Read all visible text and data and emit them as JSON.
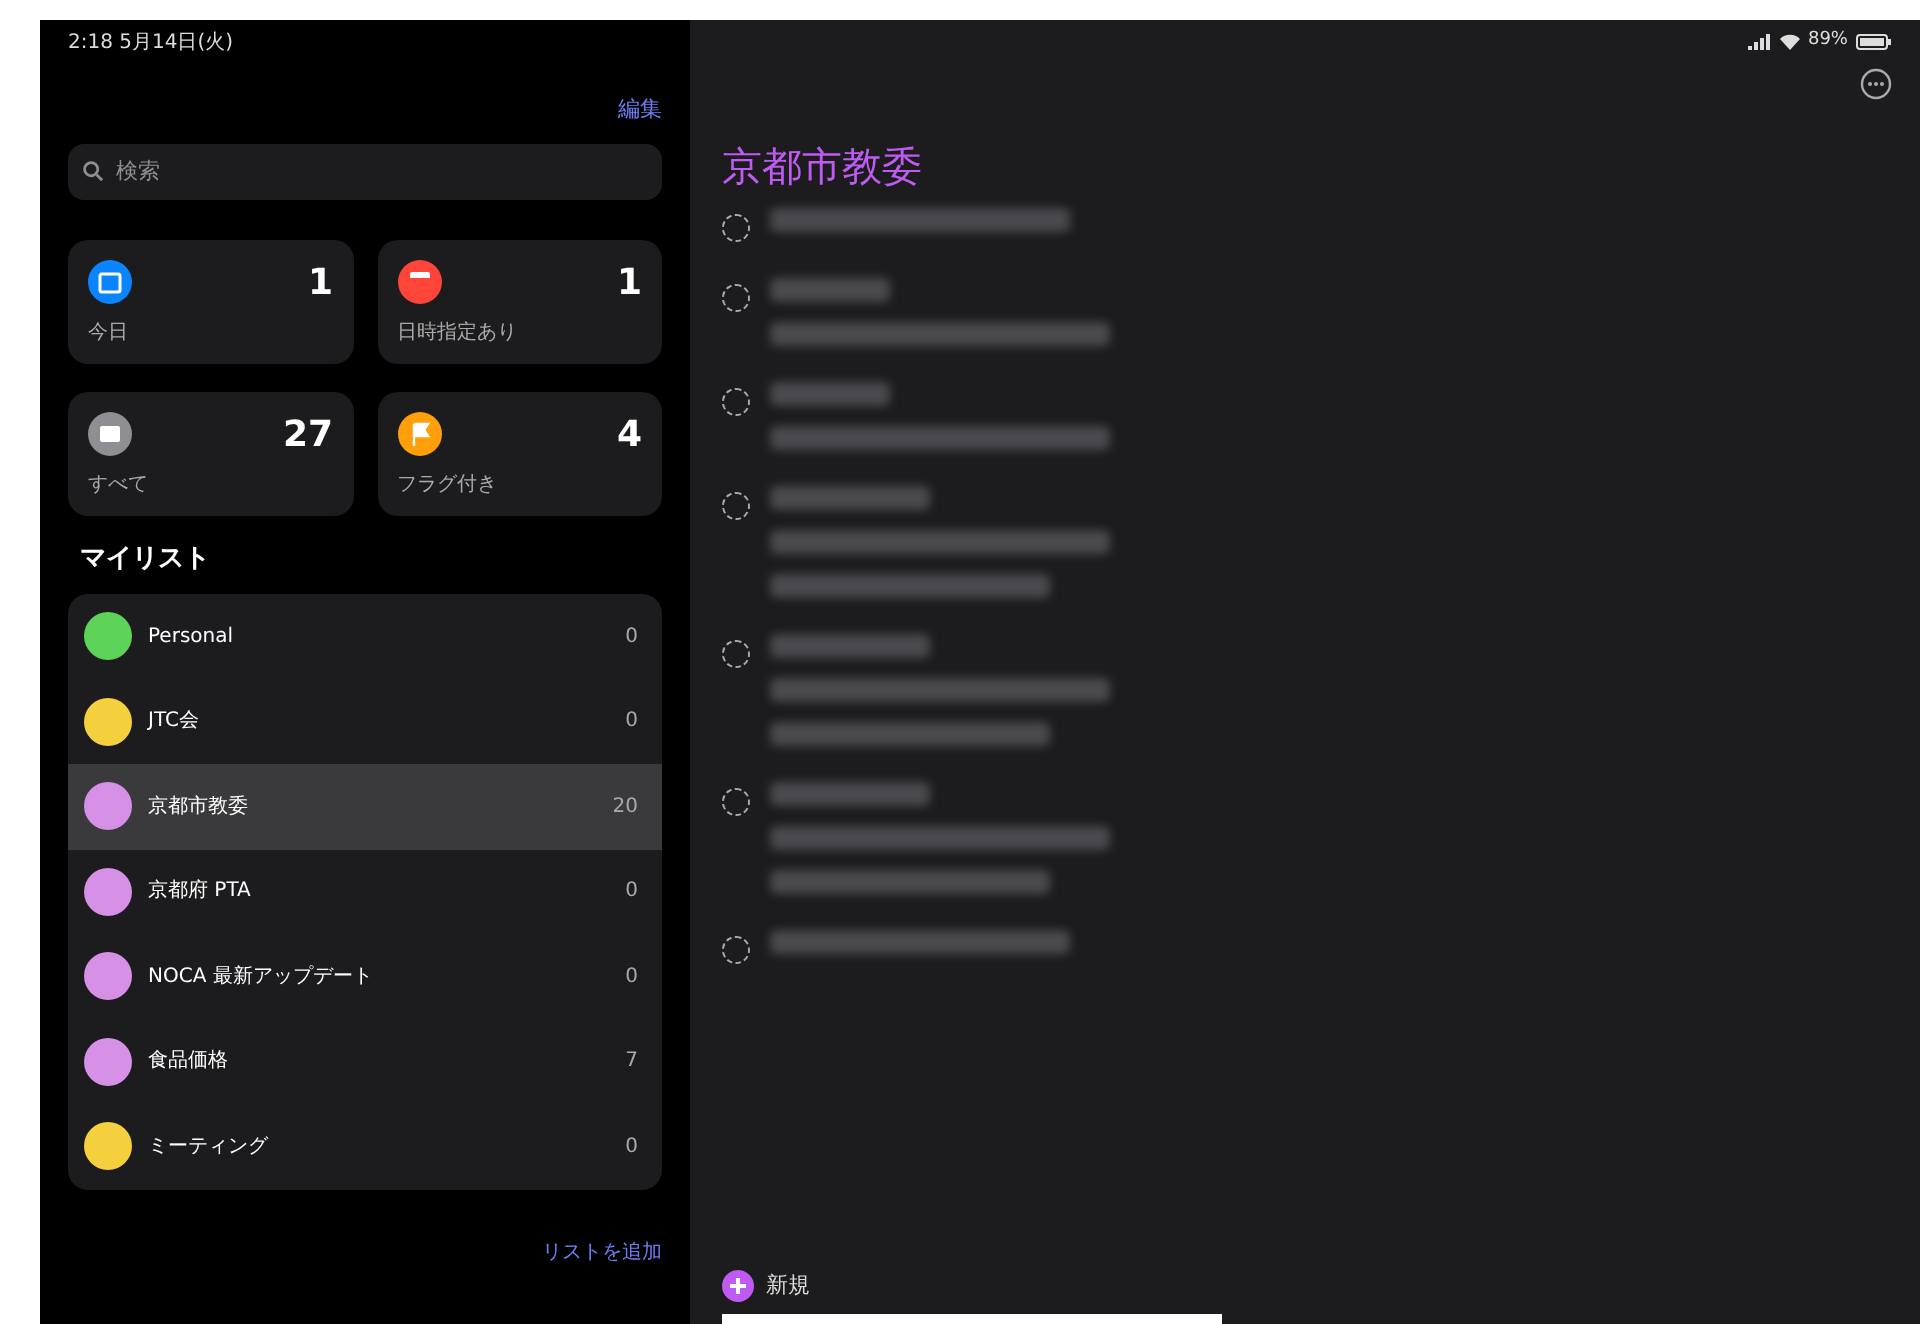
{
  "status_bar": {
    "time": "2:18 5月14日(火)",
    "battery": "89%"
  },
  "sidebar": {
    "edit_button": "編集",
    "search": {
      "placeholder": "検索"
    },
    "smart_lists": [
      {
        "label": "今日",
        "count": "1",
        "color": "#0a84ff",
        "kind": "today"
      },
      {
        "label": "日時指定あり",
        "count": "1",
        "color": "#ff453a",
        "kind": "scheduled"
      },
      {
        "label": "すべて",
        "count": "27",
        "color": "#8e8e93",
        "kind": "all"
      },
      {
        "label": "フラグ付き",
        "count": "4",
        "color": "#ff9f0a",
        "kind": "flagged"
      }
    ],
    "my_lists_heading": "マイリスト",
    "lists": [
      {
        "name": "Personal",
        "count": "0",
        "color": "#5ed35a",
        "selected": false
      },
      {
        "name": "JTC会",
        "count": "0",
        "color": "#f4d03f",
        "selected": false
      },
      {
        "name": "京都市教委",
        "count": "20",
        "color": "#d690e6",
        "selected": true
      },
      {
        "name": "京都府 PTA",
        "count": "0",
        "color": "#d690e6",
        "selected": false
      },
      {
        "name": "NOCA 最新アップデート",
        "count": "0",
        "color": "#d690e6",
        "selected": false
      },
      {
        "name": "食品価格",
        "count": "7",
        "color": "#d690e6",
        "selected": false
      },
      {
        "name": "ミーティング",
        "count": "0",
        "color": "#f4d03f",
        "selected": false
      }
    ],
    "add_list": "リストを追加"
  },
  "detail": {
    "title": "京都市教委",
    "reminders": [
      {
        "checked": false,
        "kind": "one-line"
      },
      {
        "checked": false,
        "kind": "two-line"
      },
      {
        "checked": false,
        "kind": "two-line"
      },
      {
        "checked": false,
        "kind": "three-line"
      },
      {
        "checked": false,
        "kind": "three-line"
      },
      {
        "checked": false,
        "kind": "three-line"
      },
      {
        "checked": false,
        "kind": "one-line"
      }
    ],
    "new_button": "新規"
  }
}
